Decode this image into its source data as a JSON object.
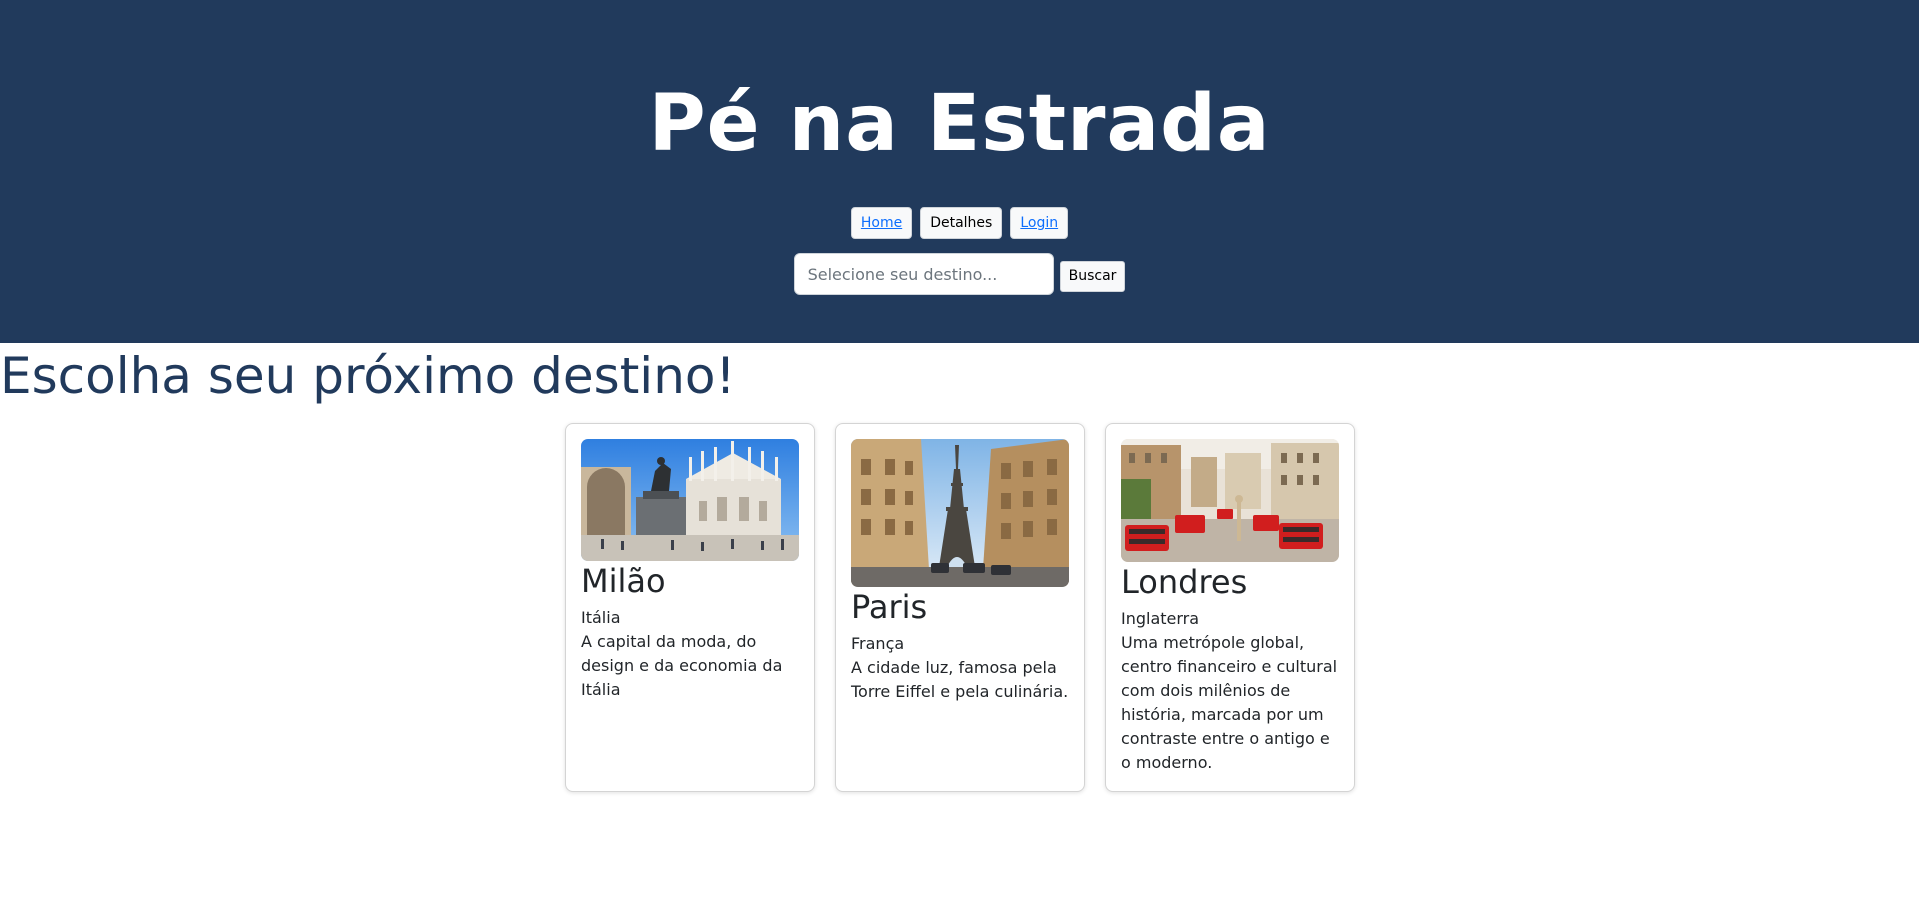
{
  "header": {
    "title": "Pé na Estrada",
    "background": "#213a5c"
  },
  "nav": {
    "home": "Home",
    "details": "Detalhes",
    "login": "Login"
  },
  "search": {
    "placeholder": "Selecione seu destino...",
    "button": "Buscar"
  },
  "main": {
    "heading": "Escolha seu próximo destino!"
  },
  "cards": [
    {
      "city": "Milão",
      "country": "Itália",
      "description": "A capital da moda, do design e da economia da Itália"
    },
    {
      "city": "Paris",
      "country": "França",
      "description": "A cidade luz, famosa pela Torre Eiffel e pela culinária."
    },
    {
      "city": "Londres",
      "country": "Inglaterra",
      "description": "Uma metrópole global, centro financeiro e cultural com dois milênios de história, marcada por um contraste entre o antigo e o moderno."
    }
  ]
}
